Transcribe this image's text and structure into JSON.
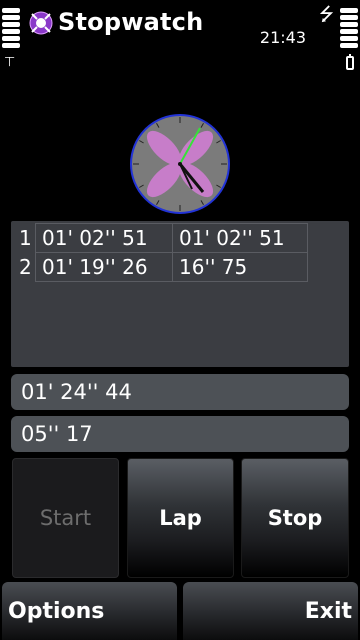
{
  "title_bar": {
    "title": "Stopwatch",
    "time": "21:43",
    "icons": [
      "stopwatch-app-icon",
      "usb-icon",
      "signal-icon",
      "battery-icon"
    ]
  },
  "laps": [
    {
      "index": "1",
      "split": "01' 02'' 51",
      "lap": "01' 02'' 51"
    },
    {
      "index": "2",
      "split": "01' 19'' 26",
      "lap": "16'' 75"
    }
  ],
  "total_time": "01' 24'' 44",
  "current_lap": "05'' 17",
  "buttons": {
    "start": "Start",
    "lap": "Lap",
    "stop": "Stop"
  },
  "softkeys": {
    "left": "Options",
    "right": "Exit"
  },
  "colors": {
    "panel": "#3b3d42",
    "field": "#4d5156",
    "petal": "#c77dc9",
    "clock_rim": "#1f2fd1",
    "second_hand": "#37e23a"
  }
}
